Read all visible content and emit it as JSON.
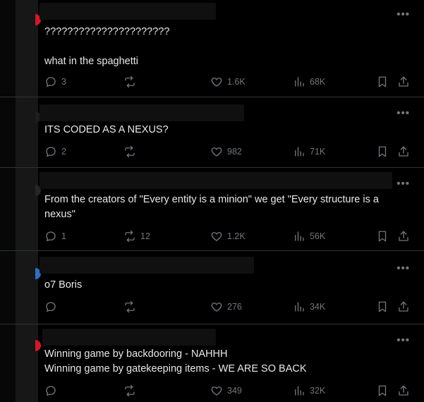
{
  "colors": {
    "background": "#000000",
    "text": "#e7e9ea",
    "muted": "#71767b",
    "divider": "#2f3336",
    "avatar_red": "#d0192b",
    "avatar_blue": "#2f6fbf"
  },
  "icons": {
    "more": "more-dots-icon",
    "reply": "reply-icon",
    "repost": "repost-icon",
    "like": "heart-icon",
    "views": "views-chart-icon",
    "bookmark": "bookmark-icon",
    "share": "share-icon"
  },
  "posts": [
    {
      "text": "??????????????????????\n\nwhat in the spaghetti",
      "replies": "3",
      "reposts": "",
      "likes": "1.6K",
      "views": "68K"
    },
    {
      "text": "ITS CODED AS A NEXUS?",
      "replies": "2",
      "reposts": "",
      "likes": "982",
      "views": "71K"
    },
    {
      "text": "From the creators of \"Every entity is a minion\" we get \"Every structure is a nexus\"",
      "replies": "1",
      "reposts": "12",
      "likes": "1.2K",
      "views": "56K"
    },
    {
      "text": "o7 Boris",
      "replies": "",
      "reposts": "",
      "likes": "276",
      "views": "34K"
    },
    {
      "text": "Winning game by backdooring - NAHHH\nWinning game by gatekeeping items - WE ARE SO BACK",
      "replies": "",
      "reposts": "",
      "likes": "349",
      "views": "32K"
    }
  ]
}
